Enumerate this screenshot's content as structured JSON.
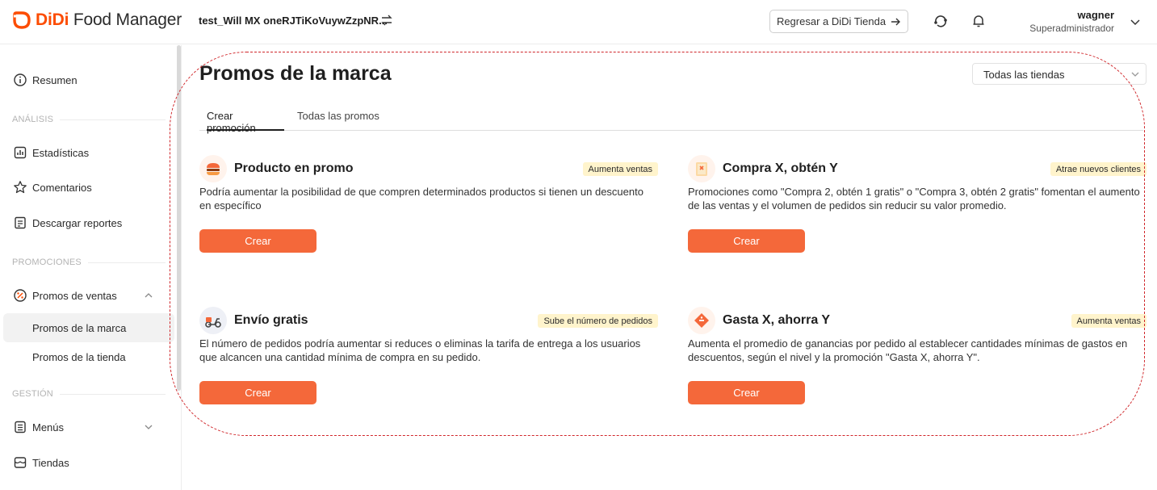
{
  "header": {
    "logo_brand": "DiDi",
    "logo_product": " Food Manager",
    "store_name": "test_Will MX oneRJTiKoVuywZzpNR...",
    "back_button": "Regresar a DiDi Tienda",
    "user_name": "wagner",
    "user_role": "Superadministrador"
  },
  "sidebar": {
    "summary": "Resumen",
    "section_analysis": "ANÁLISIS",
    "stats": "Estadísticas",
    "comments": "Comentarios",
    "reports": "Descargar reportes",
    "section_promos": "PROMOCIONES",
    "sales_promos": "Promos de ventas",
    "brand_promos": "Promos de la marca",
    "store_promos": "Promos de la tienda",
    "section_management": "GESTIÓN",
    "menus": "Menús",
    "stores": "Tiendas"
  },
  "main": {
    "title": "Promos de la marca",
    "store_filter": "Todas las tiendas",
    "tabs": [
      {
        "label": "Crear promoción"
      },
      {
        "label": "Todas las promos"
      }
    ],
    "cards": [
      {
        "title": "Producto en promo",
        "badge": "Aumenta ventas",
        "description": "Podría aumentar la posibilidad de que compren determinados productos si tienen un descuento en específico",
        "button": "Crear"
      },
      {
        "title": "Compra X, obtén Y",
        "badge": "Atrae nuevos clientes",
        "description": "Promociones como \"Compra 2, obtén 1 gratis\" o \"Compra 3, obtén 2 gratis\" fomentan el aumento de las ventas y el volumen de pedidos sin reducir su valor promedio.",
        "button": "Crear"
      },
      {
        "title": "Envío gratis",
        "badge": "Sube el número de pedidos",
        "description": "El número de pedidos podría aumentar si reduces o eliminas la tarifa de entrega a los usuarios que alcancen una cantidad mínima de compra en su pedido.",
        "button": "Crear"
      },
      {
        "title": "Gasta X, ahorra Y",
        "badge": "Aumenta ventas",
        "description": "Aumenta el promedio de ganancias por pedido al establecer cantidades mínimas de gastos en descuentos, según el nivel y la promoción \"Gasta X, ahorra Y\".",
        "button": "Crear"
      }
    ]
  },
  "colors": {
    "brand": "#fc4c02",
    "button": "#f4683a",
    "badge": "#fff4cc",
    "annotation": "#d0262a"
  }
}
